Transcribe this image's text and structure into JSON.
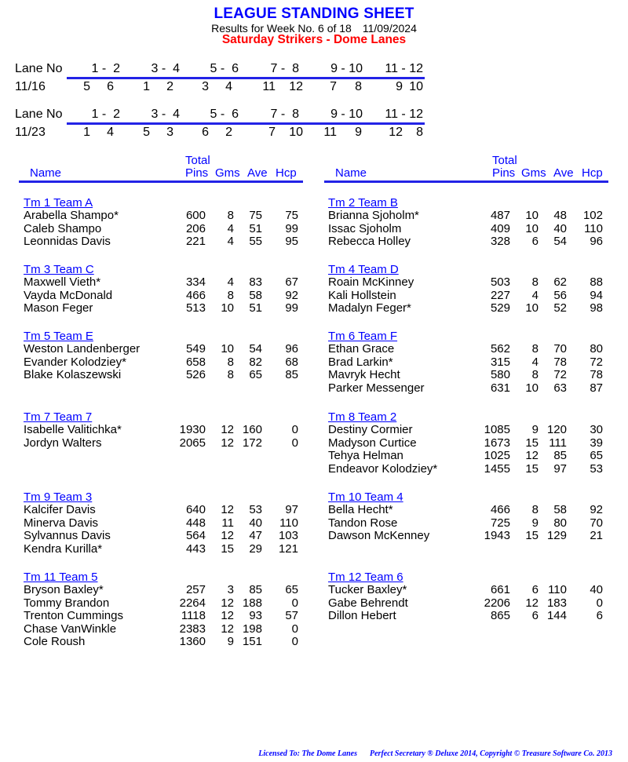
{
  "header": {
    "title": "LEAGUE STANDING SHEET",
    "results_text": "Results for Week No. 6 of 18",
    "date": "11/09/2024",
    "league_name": "Saturday Strikers - Dome Lanes"
  },
  "lane_schedule": [
    {
      "label": "Lane No",
      "lanes": [
        "1 -  2",
        "3 -  4",
        "5 -  6",
        "7 -  8",
        "9 - 10",
        "11 - 12"
      ],
      "date": "11/16",
      "matchups": [
        [
          "5",
          "6"
        ],
        [
          "1",
          "2"
        ],
        [
          "3",
          "4"
        ],
        [
          "11",
          "12"
        ],
        [
          "7",
          "8"
        ],
        [
          "9",
          "10"
        ]
      ]
    },
    {
      "label": "Lane No",
      "lanes": [
        "1 -  2",
        "3 -  4",
        "5 -  6",
        "7 -  8",
        "9 - 10",
        "11 - 12"
      ],
      "date": "11/23",
      "matchups": [
        [
          "1",
          "4"
        ],
        [
          "5",
          "3"
        ],
        [
          "6",
          "2"
        ],
        [
          "7",
          "10"
        ],
        [
          "11",
          "9"
        ],
        [
          "12",
          "8"
        ]
      ]
    }
  ],
  "columns": {
    "name": "Name",
    "total": "Total",
    "pins": "Pins",
    "gms": "Gms",
    "ave": "Ave",
    "hcp": "Hcp"
  },
  "teams": [
    {
      "name": "Tm 1 Team A",
      "players": [
        {
          "name": "Arabella Shampo*",
          "pins": "600",
          "gms": "8",
          "ave": "75",
          "hcp": "75"
        },
        {
          "name": "Caleb Shampo",
          "pins": "206",
          "gms": "4",
          "ave": "51",
          "hcp": "99"
        },
        {
          "name": "Leonnidas Davis",
          "pins": "221",
          "gms": "4",
          "ave": "55",
          "hcp": "95"
        }
      ]
    },
    {
      "name": "Tm 2 Team B",
      "players": [
        {
          "name": "Brianna Sjoholm*",
          "pins": "487",
          "gms": "10",
          "ave": "48",
          "hcp": "102"
        },
        {
          "name": "Issac Sjoholm",
          "pins": "409",
          "gms": "10",
          "ave": "40",
          "hcp": "110"
        },
        {
          "name": "Rebecca Holley",
          "pins": "328",
          "gms": "6",
          "ave": "54",
          "hcp": "96"
        }
      ]
    },
    {
      "name": "Tm 3 Team C",
      "players": [
        {
          "name": "Maxwell Vieth*",
          "pins": "334",
          "gms": "4",
          "ave": "83",
          "hcp": "67"
        },
        {
          "name": "Vayda McDonald",
          "pins": "466",
          "gms": "8",
          "ave": "58",
          "hcp": "92"
        },
        {
          "name": "Mason Feger",
          "pins": "513",
          "gms": "10",
          "ave": "51",
          "hcp": "99"
        }
      ]
    },
    {
      "name": "Tm 4 Team D",
      "players": [
        {
          "name": "Roain McKinney",
          "pins": "503",
          "gms": "8",
          "ave": "62",
          "hcp": "88"
        },
        {
          "name": "Kali Hollstein",
          "pins": "227",
          "gms": "4",
          "ave": "56",
          "hcp": "94"
        },
        {
          "name": "Madalyn Feger*",
          "pins": "529",
          "gms": "10",
          "ave": "52",
          "hcp": "98"
        }
      ]
    },
    {
      "name": "Tm 5 Team E",
      "players": [
        {
          "name": "Weston Landenberger",
          "pins": "549",
          "gms": "10",
          "ave": "54",
          "hcp": "96"
        },
        {
          "name": "Evander Kolodziey*",
          "pins": "658",
          "gms": "8",
          "ave": "82",
          "hcp": "68"
        },
        {
          "name": "Blake Kolaszewski",
          "pins": "526",
          "gms": "8",
          "ave": "65",
          "hcp": "85"
        }
      ]
    },
    {
      "name": "Tm 6 Team F",
      "players": [
        {
          "name": "Ethan Grace",
          "pins": "562",
          "gms": "8",
          "ave": "70",
          "hcp": "80"
        },
        {
          "name": "Brad Larkin*",
          "pins": "315",
          "gms": "4",
          "ave": "78",
          "hcp": "72"
        },
        {
          "name": "Mavryk Hecht",
          "pins": "580",
          "gms": "8",
          "ave": "72",
          "hcp": "78"
        },
        {
          "name": "Parker Messenger",
          "pins": "631",
          "gms": "10",
          "ave": "63",
          "hcp": "87"
        }
      ]
    },
    {
      "name": "Tm 7 Team 7",
      "players": [
        {
          "name": "Isabelle Valitichka*",
          "pins": "1930",
          "gms": "12",
          "ave": "160",
          "hcp": "0"
        },
        {
          "name": "Jordyn Walters",
          "pins": "2065",
          "gms": "12",
          "ave": "172",
          "hcp": "0"
        }
      ]
    },
    {
      "name": "Tm 8 Team 2",
      "players": [
        {
          "name": "Destiny Cormier",
          "pins": "1085",
          "gms": "9",
          "ave": "120",
          "hcp": "30"
        },
        {
          "name": "Madyson Curtice",
          "pins": "1673",
          "gms": "15",
          "ave": "111",
          "hcp": "39"
        },
        {
          "name": "Tehya Helman",
          "pins": "1025",
          "gms": "12",
          "ave": "85",
          "hcp": "65"
        },
        {
          "name": "Endeavor Kolodziey*",
          "pins": "1455",
          "gms": "15",
          "ave": "97",
          "hcp": "53"
        }
      ]
    },
    {
      "name": "Tm 9 Team 3",
      "players": [
        {
          "name": "Kalcifer Davis",
          "pins": "640",
          "gms": "12",
          "ave": "53",
          "hcp": "97"
        },
        {
          "name": "Minerva Davis",
          "pins": "448",
          "gms": "11",
          "ave": "40",
          "hcp": "110"
        },
        {
          "name": "Sylvannus Davis",
          "pins": "564",
          "gms": "12",
          "ave": "47",
          "hcp": "103"
        },
        {
          "name": "Kendra Kurilla*",
          "pins": "443",
          "gms": "15",
          "ave": "29",
          "hcp": "121"
        }
      ]
    },
    {
      "name": "Tm 10 Team 4",
      "players": [
        {
          "name": "Bella Hecht*",
          "pins": "466",
          "gms": "8",
          "ave": "58",
          "hcp": "92"
        },
        {
          "name": "Tandon Rose",
          "pins": "725",
          "gms": "9",
          "ave": "80",
          "hcp": "70"
        },
        {
          "name": "Dawson McKenney",
          "pins": "1943",
          "gms": "15",
          "ave": "129",
          "hcp": "21"
        }
      ]
    },
    {
      "name": "Tm 11 Team 5",
      "players": [
        {
          "name": "Bryson Baxley*",
          "pins": "257",
          "gms": "3",
          "ave": "85",
          "hcp": "65"
        },
        {
          "name": "Tommy Brandon",
          "pins": "2264",
          "gms": "12",
          "ave": "188",
          "hcp": "0"
        },
        {
          "name": "Trenton Cummings",
          "pins": "1118",
          "gms": "12",
          "ave": "93",
          "hcp": "57"
        },
        {
          "name": "Chase VanWinkle",
          "pins": "2383",
          "gms": "12",
          "ave": "198",
          "hcp": "0"
        },
        {
          "name": "Cole Roush",
          "pins": "1360",
          "gms": "9",
          "ave": "151",
          "hcp": "0"
        }
      ]
    },
    {
      "name": "Tm 12 Team 6",
      "players": [
        {
          "name": "Tucker Baxley*",
          "pins": "661",
          "gms": "6",
          "ave": "110",
          "hcp": "40"
        },
        {
          "name": "Gabe Behrendt",
          "pins": "2206",
          "gms": "12",
          "ave": "183",
          "hcp": "0"
        },
        {
          "name": "Dillon Hebert",
          "pins": "865",
          "gms": "6",
          "ave": "144",
          "hcp": "6"
        }
      ]
    }
  ],
  "footer": {
    "licensed": "Licensed To: The Dome Lanes",
    "copyright": "Perfect Secretary ® Deluxe  2014, Copyright © Treasure Software Co. 2013"
  },
  "colors": {
    "title": "#0000ff",
    "league": "#ff0000",
    "rule": "#2323e6",
    "team_link": "#0000ff"
  }
}
